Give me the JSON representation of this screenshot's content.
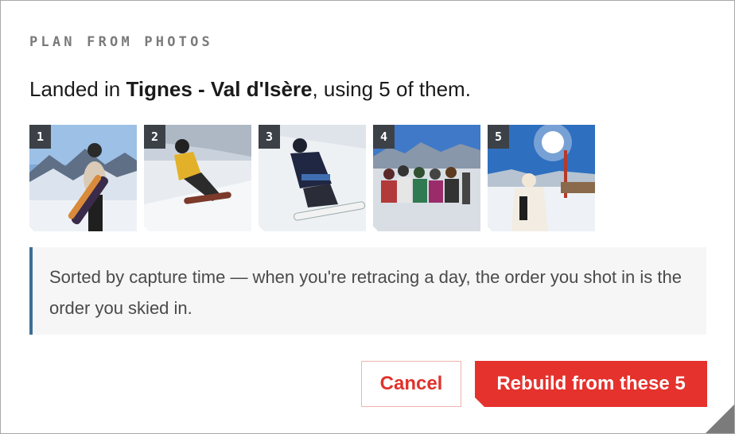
{
  "dialog": {
    "eyebrow": "PLAN FROM PHOTOS",
    "headline": {
      "prefix": "Landed in ",
      "location": "Tignes - Val d'Isère",
      "suffix": ", using 5 of them."
    },
    "photos": [
      {
        "index": "1",
        "subject": "snowboarder holding patterned board, mountains behind"
      },
      {
        "index": "2",
        "subject": "snowboarder in yellow jacket carving on slope"
      },
      {
        "index": "3",
        "subject": "snowboarder in navy jacket riding downhill"
      },
      {
        "index": "4",
        "subject": "group of skiers sitting in snow"
      },
      {
        "index": "5",
        "subject": "skier in white jacket under bright sun"
      }
    ],
    "note": "Sorted by capture time — when you're retracing a day, the order you shot in is the order you skied in.",
    "buttons": {
      "cancel": "Cancel",
      "primary": "Rebuild from these 5"
    },
    "colors": {
      "accent": "#e5322d",
      "note_border": "#3e6f96",
      "badge_bg": "#3c4148"
    }
  }
}
